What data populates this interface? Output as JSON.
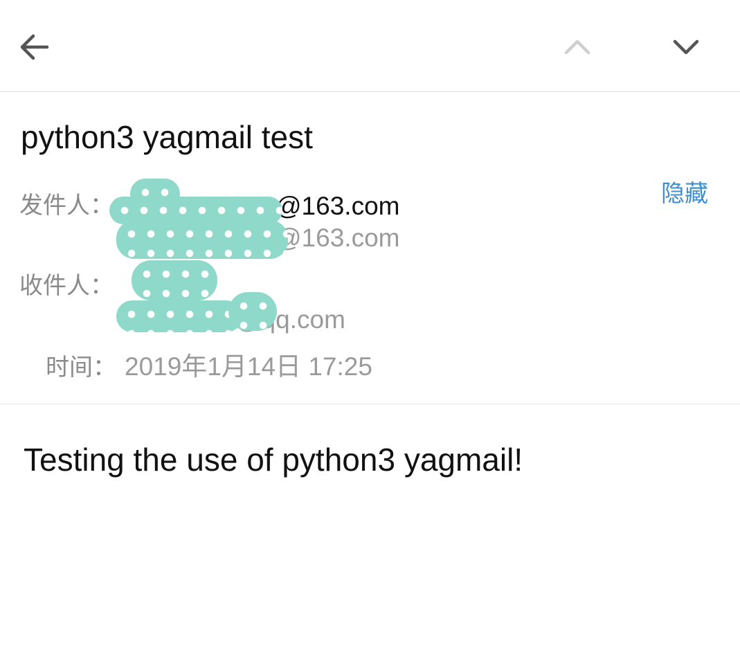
{
  "toolbar": {
    "back_icon": "arrow-left-icon",
    "prev_icon": "chevron-up-icon",
    "next_icon": "chevron-down-icon"
  },
  "email": {
    "subject": "python3 yagmail test",
    "hide_label": "隐藏",
    "sender_label": "发件人：",
    "sender_name_visible": "@163.com",
    "sender_address_visible": "@163.com",
    "recipient_label": "收件人：",
    "recipient_address_visible": "@qq.com",
    "time_label": "时间：",
    "time_value": "2019年1月14日 17:25",
    "body": "Testing the use of python3 yagmail!"
  },
  "colors": {
    "accent_link": "#3d8fd1",
    "label_grey": "#8a8a8a",
    "redaction": "#8fd9cb"
  }
}
